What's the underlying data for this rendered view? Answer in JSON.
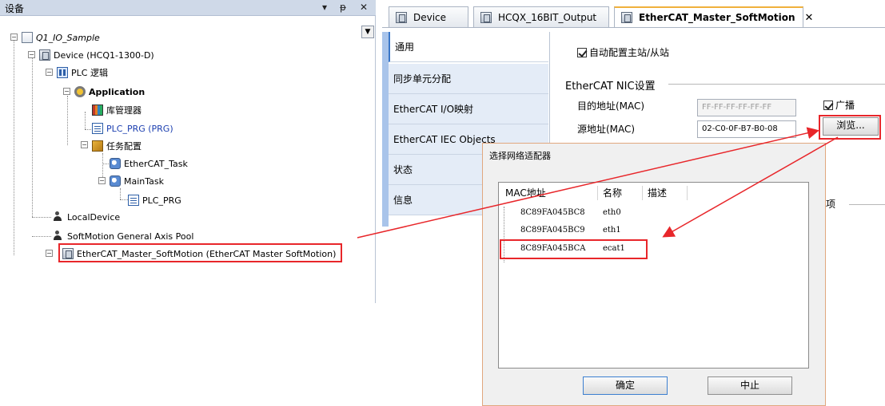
{
  "left_pane": {
    "title": "设备",
    "ctrl_dropdown": "▾",
    "ctrl_pin": "ᵽ",
    "ctrl_close": "✕",
    "tree": {
      "root": "Q1_IO_Sample",
      "device": "Device (HCQ1-1300-D)",
      "plc_logic": "PLC 逻辑",
      "application": "Application",
      "library_manager": "库管理器",
      "plc_prg": "PLC_PRG (PRG)",
      "task_config": "任务配置",
      "ethercat_task": "EtherCAT_Task",
      "main_task": "MainTask",
      "main_task_prg": "PLC_PRG",
      "local_device": "LocalDevice",
      "axis_pool": "SoftMotion General Axis Pool",
      "ethercat_master": "EtherCAT_Master_SoftMotion (EtherCAT Master SoftMotion)"
    }
  },
  "tabs": [
    {
      "label": "Device"
    },
    {
      "label": "HCQX_16BIT_Output"
    },
    {
      "label": "EtherCAT_Master_SoftMotion"
    }
  ],
  "tab_close": "✕",
  "side_tabs": [
    "通用",
    "同步单元分配",
    "EtherCAT I/O映射",
    "EtherCAT IEC Objects",
    "状态",
    "信息"
  ],
  "general": {
    "auto_config": "自动配置主站/从站",
    "nic_group": "EtherCAT  NIC设置",
    "dest_label": "目的地址(MAC)",
    "dest_value": "FF-FF-FF-FF-FF-FF",
    "broadcast": "广播",
    "src_label": "源地址(MAC)",
    "src_value": "02-C0-0F-B7-B0-08",
    "browse": "浏览...",
    "options_fragment": "项"
  },
  "dialog": {
    "title": "选择网络适配器",
    "columns": [
      "MAC地址",
      "名称",
      "描述"
    ],
    "rows": [
      {
        "mac": "8C89FA045BC8",
        "name": "eth0",
        "desc": ""
      },
      {
        "mac": "8C89FA045BC9",
        "name": "eth1",
        "desc": ""
      },
      {
        "mac": "8C89FA045BCA",
        "name": "ecat1",
        "desc": ""
      }
    ],
    "ok": "确定",
    "cancel": "中止"
  },
  "colors": {
    "highlight_red": "#e8262a",
    "header_blue": "#cfd9e8",
    "tab_accent": "#f0b03c"
  }
}
